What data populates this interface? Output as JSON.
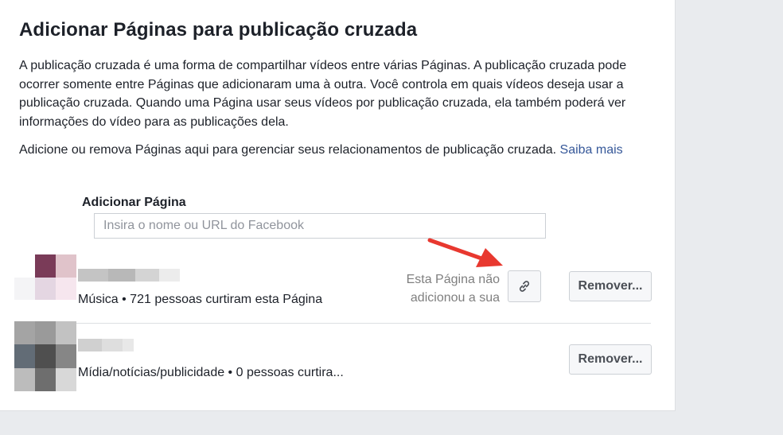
{
  "dialog": {
    "title": "Adicionar Páginas para publicação cruzada",
    "description": "A publicação cruzada é uma forma de compartilhar vídeos entre várias Páginas. A publicação cruzada pode ocorrer somente entre Páginas que adicionaram uma à outra. Você controla em quais vídeos deseja usar a publicação cruzada. Quando uma Página usar seus vídeos por publicação cruzada, ela também poderá ver informações do vídeo para as publicações dela.",
    "manage_text": "Adicione ou remova Páginas aqui para gerenciar seus relacionamentos de publicação cruzada. ",
    "learn_more": "Saiba mais"
  },
  "add_page": {
    "label": "Adicionar Página",
    "placeholder": "Insira o nome ou URL do Facebook",
    "value": ""
  },
  "pages": [
    {
      "meta": "Música • 721 pessoas curtiram esta Página",
      "status": "Esta Página não adicionou a sua",
      "remove_label": "Remover...",
      "link_icon": "link-icon",
      "avatar_colors": [
        "#ffffff",
        "#7a3b58",
        "#e0c3ca",
        "#f4f4f6",
        "#e4d6e2",
        "#f6e6ee",
        "#ffffff",
        "#ffffff",
        "#ffffff"
      ],
      "name_colors": [
        "#c4c4c4",
        "#b8b8b8",
        "#d4d4d4",
        "#ececec"
      ]
    },
    {
      "meta": "Mídia/notícias/publicidade • 0 pessoas curtira...",
      "status": "",
      "remove_label": "Remover...",
      "avatar_colors": [
        "#a4a4a4",
        "#9a9a9a",
        "#c2c2c2",
        "#626c76",
        "#4f4f4f",
        "#868686",
        "#bcbcbc",
        "#6e6e6e",
        "#d8d8d8"
      ],
      "name_colors": [
        "#d0d0d0",
        "#dedede",
        "#e8e8e8"
      ]
    }
  ],
  "annotation": {
    "arrow_color": "#e8382f"
  }
}
